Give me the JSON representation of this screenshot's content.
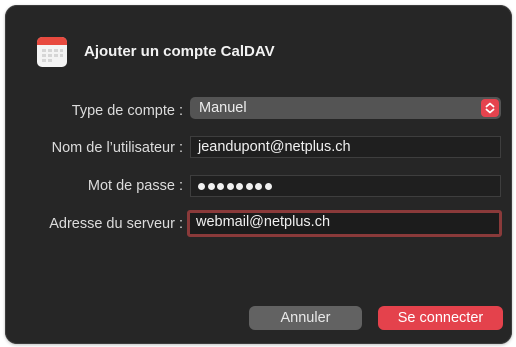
{
  "dialog": {
    "title": "Ajouter un compte CalDAV",
    "icon": "calendar-icon"
  },
  "form": {
    "account_type": {
      "label": "Type de compte :",
      "value": "Manuel"
    },
    "username": {
      "label": "Nom de l’utilisateur :",
      "value": "jeandupont@netplus.ch"
    },
    "password": {
      "label": "Mot de passe :",
      "masked_length": 8
    },
    "server": {
      "label": "Adresse du serveur :",
      "value": "webmail@netplus.ch"
    }
  },
  "buttons": {
    "cancel_label": "Annuler",
    "connect_label": "Se connecter"
  },
  "colors": {
    "dialog_bg": "#262626",
    "accent": "#e4424c",
    "focus_ring": "#8a3a3a",
    "calendar_red": "#e84a3f"
  }
}
